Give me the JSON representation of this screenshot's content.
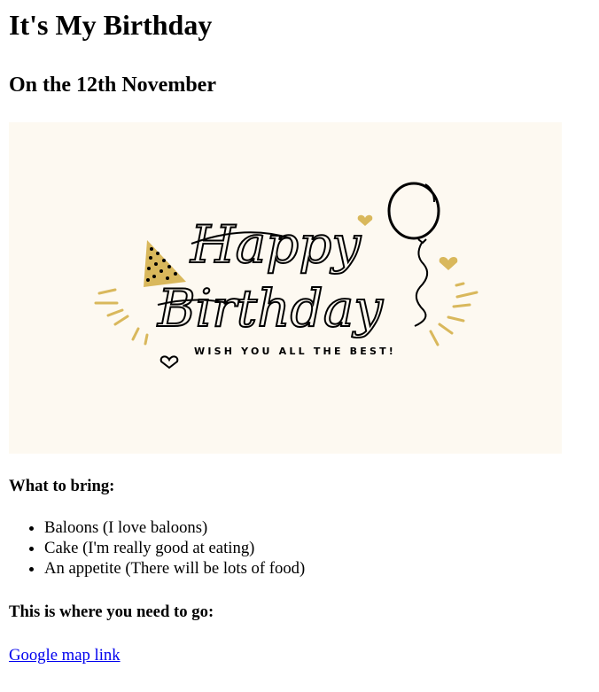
{
  "page": {
    "title": "It's My Birthday",
    "subtitle": "On the 12th November"
  },
  "banner": {
    "headline_line1": "Happy",
    "headline_line2": "Birthday",
    "tagline": "WISH YOU ALL THE BEST!",
    "background_color": "#fdf9f1",
    "accent_color": "#d9b85c"
  },
  "bring": {
    "heading": "What to bring:",
    "items": [
      "Baloons (I love baloons)",
      "Cake (I'm really good at eating)",
      "An appetite (There will be lots of food)"
    ]
  },
  "directions": {
    "heading": "This is where you need to go:",
    "link_text": "Google map link"
  }
}
